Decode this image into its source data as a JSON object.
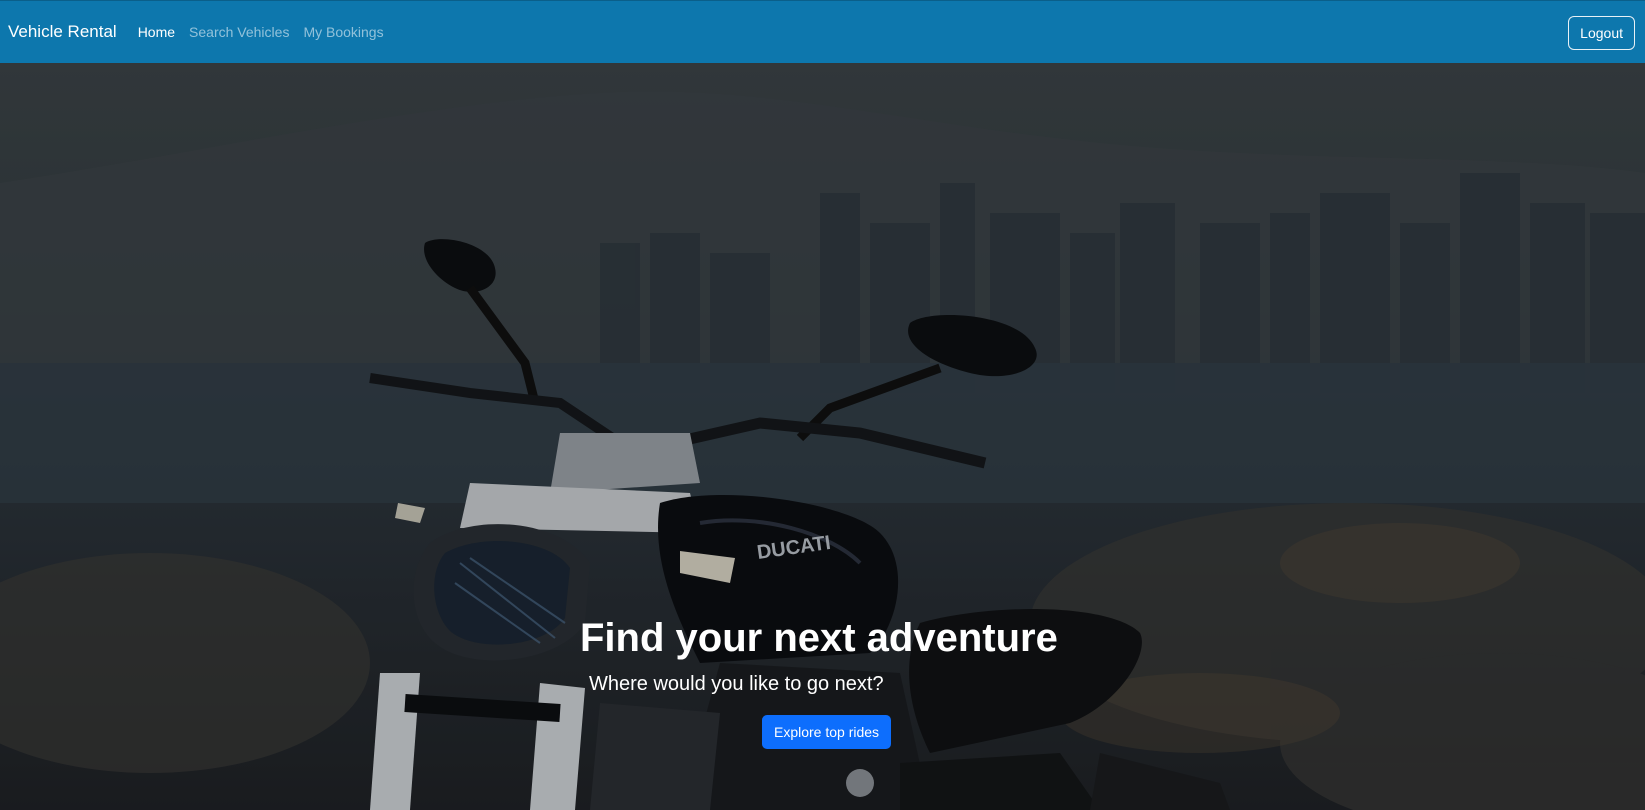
{
  "navbar": {
    "brand": "Vehicle Rental",
    "links": [
      {
        "label": "Home",
        "active": true
      },
      {
        "label": "Search Vehicles",
        "active": false
      },
      {
        "label": "My Bookings",
        "active": false
      }
    ],
    "logout_label": "Logout"
  },
  "hero": {
    "title": "Find your next adventure",
    "subtitle": "Where would you like to go next?",
    "cta_label": "Explore top rides",
    "tank_brand": "DUCATI"
  },
  "colors": {
    "navbar_bg": "#0d77ad",
    "cta_bg": "#0d6efd"
  }
}
